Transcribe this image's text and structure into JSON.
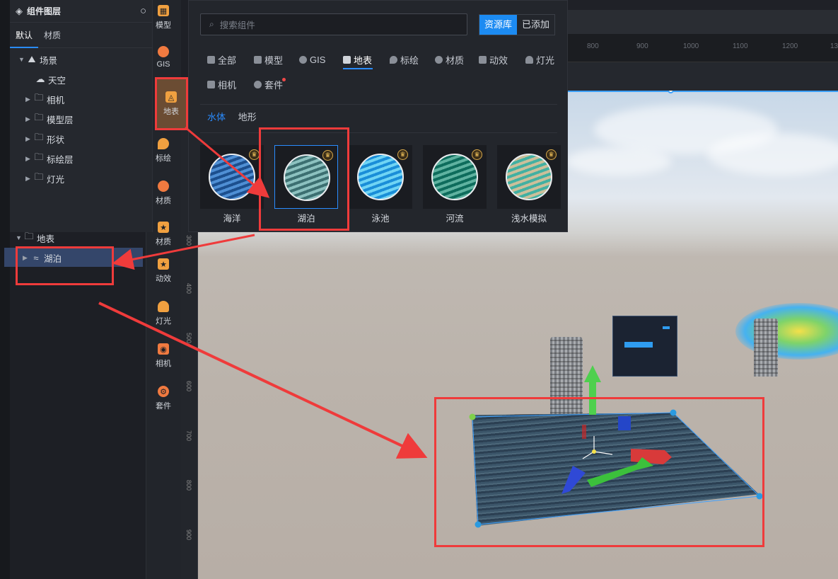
{
  "layer_panel": {
    "title": "组件图层",
    "tabs": [
      "默认",
      "材质"
    ],
    "tree": {
      "scene": "场景",
      "sky": "天空",
      "camera": "相机",
      "model_layer": "模型层",
      "shape": "形状",
      "marker_layer": "标绘层",
      "light": "灯光",
      "surface": "地表",
      "lake": "湖泊"
    }
  },
  "icon_column": {
    "items": [
      "模型",
      "GIS",
      "地表",
      "标绘",
      "材质",
      "材质",
      "动效",
      "灯光",
      "相机",
      "套件"
    ]
  },
  "component_panel": {
    "search_placeholder": "搜索组件",
    "btn_library": "资源库",
    "btn_added": "已添加",
    "categories": [
      "全部",
      "模型",
      "GIS",
      "地表",
      "标绘",
      "材质",
      "动效",
      "灯光",
      "相机",
      "套件"
    ],
    "subtabs": [
      "水体",
      "地形"
    ],
    "cards": [
      {
        "label": "海洋",
        "color1": "#1c4f8e",
        "color2": "#4f8fd4"
      },
      {
        "label": "湖泊",
        "color1": "#3c6f71",
        "color2": "#8cc1bf"
      },
      {
        "label": "泳池",
        "color1": "#1a8ed8",
        "color2": "#6fd4f4"
      },
      {
        "label": "河流",
        "color1": "#0e6c5c",
        "color2": "#5fb2a0"
      },
      {
        "label": "浅水模拟",
        "color1": "#cbbf9a",
        "color2": "#42b0a2"
      }
    ]
  },
  "ruler": {
    "top_ticks": [
      "800",
      "900",
      "1000",
      "1100",
      "1200",
      "13"
    ],
    "left_ticks": [
      "300",
      "400",
      "500",
      "600",
      "700",
      "800",
      "900"
    ]
  },
  "colors": {
    "accent": "#1c8bf2",
    "highlight": "#ef3b3b",
    "active_icon": "#6b4c33"
  }
}
